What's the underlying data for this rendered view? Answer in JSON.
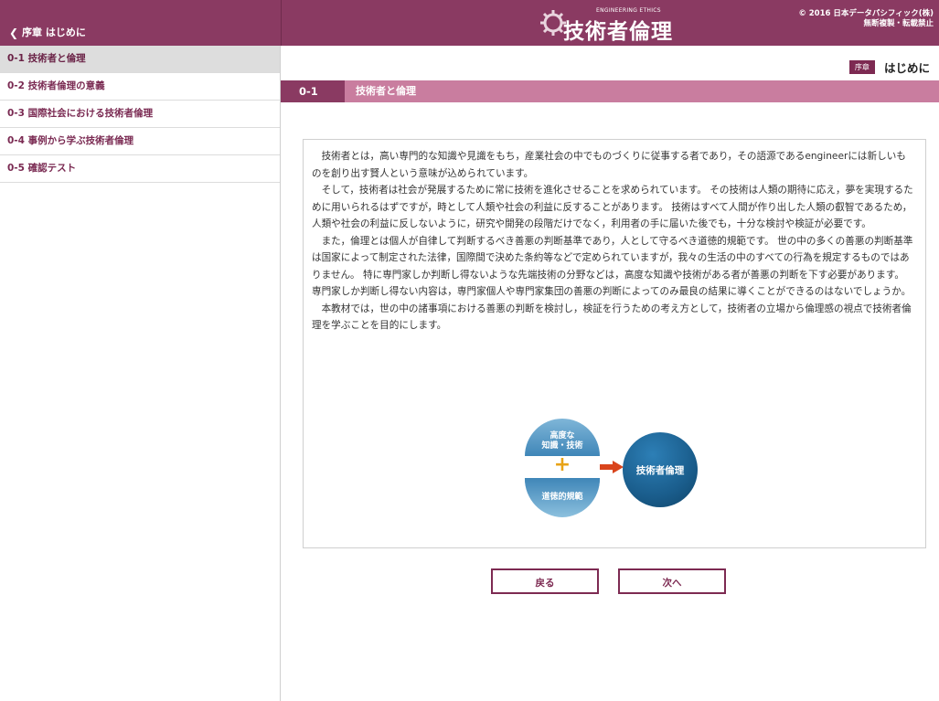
{
  "header": {
    "back_label": "序章 はじめに",
    "logo_subtitle": "ENGINEERING ETHICS",
    "logo_title": "技術者倫理",
    "copyright_line1": "© 2016 日本データパシフィック(株)",
    "copyright_line2": "無断複製・転載禁止"
  },
  "sidebar": {
    "items": [
      {
        "label": "0-1 技術者と倫理"
      },
      {
        "label": "0-2 技術者倫理の意義"
      },
      {
        "label": "0-3 国際社会における技術者倫理"
      },
      {
        "label": "0-4 事例から学ぶ技術者倫理"
      },
      {
        "label": "0-5 確認テスト"
      }
    ]
  },
  "chapter": {
    "badge": "序章",
    "title": "はじめに"
  },
  "section": {
    "number": "0-1",
    "title": "技術者と倫理"
  },
  "content": {
    "paragraphs": [
      "技術者とは，高い専門的な知識や見識をもち，産業社会の中でものづくりに従事する者であり，その語源であるengineerには新しいものを創り出す賢人という意味が込められています。",
      "そして，技術者は社会が発展するために常に技術を進化させることを求められています。 その技術は人類の期待に応え，夢を実現するために用いられるはずですが，時として人類や社会の利益に反することがあります。 技術はすべて人間が作り出した人類の叡智であるため，人類や社会の利益に反しないように，研究や開発の段階だけでなく，利用者の手に届いた後でも，十分な検討や検証が必要です。",
      "また，倫理とは個人が自律して判断するべき善悪の判断基準であり，人として守るべき道徳的規範です。 世の中の多くの善悪の判断基準は国家によって制定された法律，国際間で決めた条約等などで定められていますが，我々の生活の中のすべての行為を規定するものではありません。 特に専門家しか判断し得ないような先端技術の分野などは，高度な知識や技術がある者が善悪の判断を下す必要があります。 専門家しか判断し得ない内容は，専門家個人や専門家集団の善悪の判断によってのみ最良の結果に導くことができるのはないでしょうか。",
      "本教材では，世の中の諸事項における善悪の判断を検討し，検証を行うための考え方として，技術者の立場から倫理感の視点で技術者倫理を学ぶことを目的にします。"
    ]
  },
  "diagram": {
    "left_top": "高度な\n知識・技術",
    "plus": "+",
    "left_bottom": "道徳的規範",
    "right": "技術者倫理"
  },
  "buttons": {
    "prev": "戻る",
    "next": "次へ"
  }
}
